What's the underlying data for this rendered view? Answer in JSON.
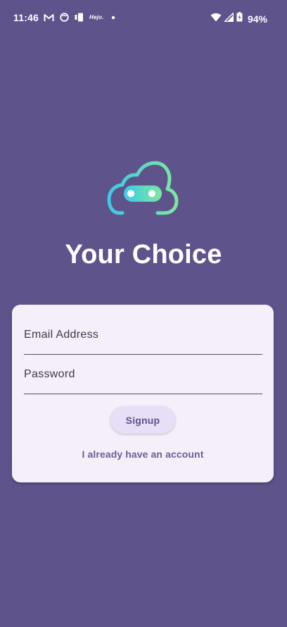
{
  "status_bar": {
    "time": "11:46",
    "notification_icons": [
      "gmail-icon",
      "app-circle-icon",
      "sim-card-icon",
      "hejo-app-icon",
      "dot-icon"
    ],
    "hejo_label": "Hejo.",
    "battery_percent": "94%"
  },
  "app": {
    "title": "Your Choice",
    "logo_icon": "cloud-robot-logo-icon",
    "logo_gradient": [
      "#3ec9e6",
      "#7de8a0"
    ]
  },
  "form": {
    "email_label": "Email Address",
    "password_label": "Password",
    "signup_label": "Signup",
    "login_link": "I already have an account"
  },
  "colors": {
    "background": "#5f538b",
    "card": "#f5effa",
    "button": "#e6dff7",
    "accent": "#6a5f9a"
  }
}
